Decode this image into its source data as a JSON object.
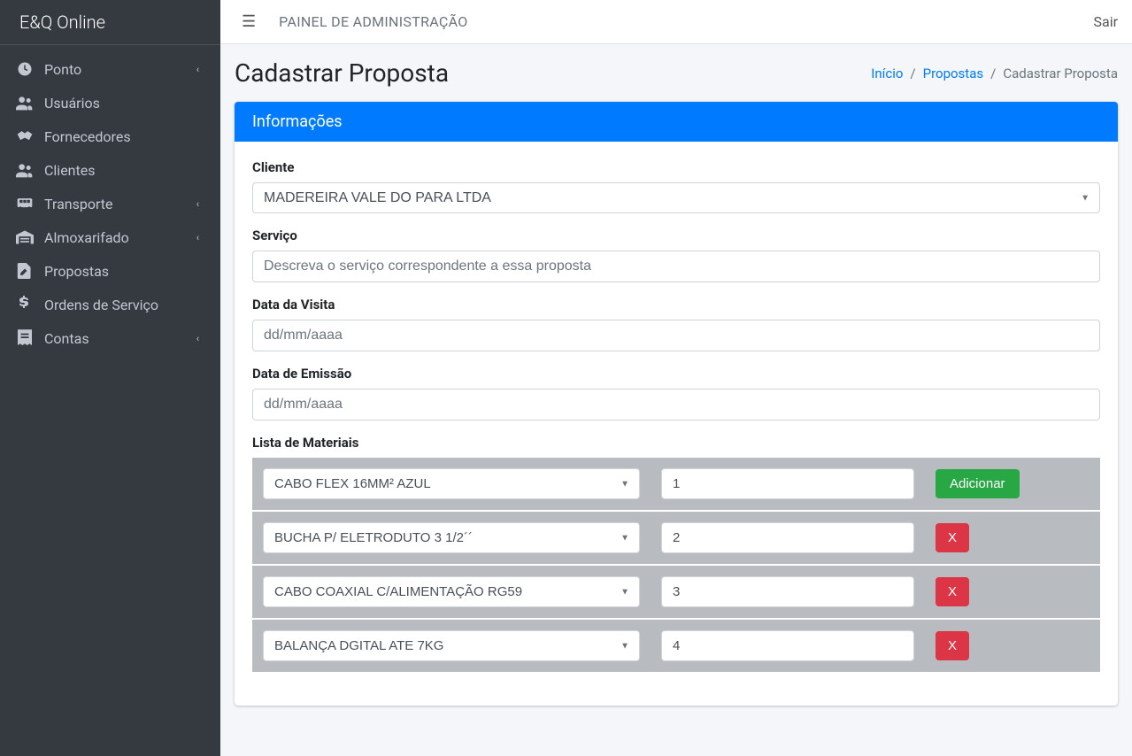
{
  "brand": "E&Q Online",
  "sidebar": {
    "items": [
      {
        "label": "Ponto",
        "hasChildren": true
      },
      {
        "label": "Usuários",
        "hasChildren": false
      },
      {
        "label": "Fornecedores",
        "hasChildren": false
      },
      {
        "label": "Clientes",
        "hasChildren": false
      },
      {
        "label": "Transporte",
        "hasChildren": true
      },
      {
        "label": "Almoxarifado",
        "hasChildren": true
      },
      {
        "label": "Propostas",
        "hasChildren": false
      },
      {
        "label": "Ordens de Serviço",
        "hasChildren": false
      },
      {
        "label": "Contas",
        "hasChildren": true
      }
    ]
  },
  "topbar": {
    "title": "PAINEL DE ADMINISTRAÇÃO",
    "logout": "Sair"
  },
  "page": {
    "title": "Cadastrar Proposta"
  },
  "breadcrumb": {
    "home": "Início",
    "proposals": "Propostas",
    "current": "Cadastrar Proposta"
  },
  "panel": {
    "header": "Informações"
  },
  "form": {
    "cliente": {
      "label": "Cliente",
      "value": "MADEREIRA VALE DO PARA LTDA"
    },
    "servico": {
      "label": "Serviço",
      "placeholder": "Descreva o serviço correspondente a essa proposta"
    },
    "dataVisita": {
      "label": "Data da Visita",
      "placeholder": "dd/mm/aaaa"
    },
    "dataEmissao": {
      "label": "Data de Emissão",
      "placeholder": "dd/mm/aaaa"
    },
    "materiais": {
      "label": "Lista de Materiais",
      "addButton": "Adicionar",
      "removeButton": "X",
      "rows": [
        {
          "material": "CABO FLEX 16MM² AZUL",
          "qty": "1"
        },
        {
          "material": "BUCHA P/ ELETRODUTO 3 1/2´´",
          "qty": "2"
        },
        {
          "material": "CABO COAXIAL C/ALIMENTAÇÃO RG59",
          "qty": "3"
        },
        {
          "material": "BALANÇA DGITAL ATE 7KG",
          "qty": "4"
        }
      ]
    }
  }
}
